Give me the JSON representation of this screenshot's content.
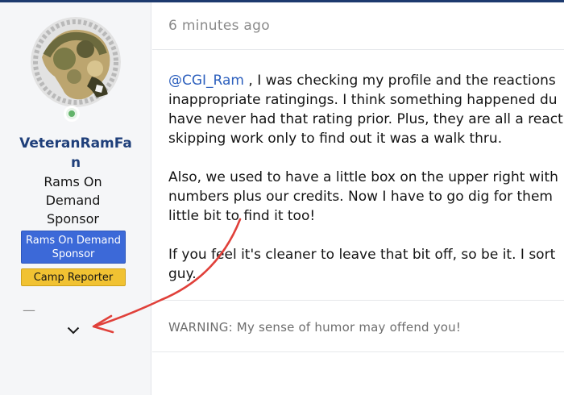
{
  "post": {
    "timestamp": "6 minutes ago",
    "paragraphs": [
      {
        "mention": "@CGI_Ram",
        "lines": [
          " , I was checking my profile and the reactions",
          "inappropriate ratingings. I think something happened du",
          "have never had that rating prior. Plus, they are all a react",
          "skipping work only to find out it was a walk thru."
        ]
      },
      {
        "lines": [
          "Also, we used to have a little box on the upper right with",
          "numbers plus our credits. Now I have to go dig for them",
          "little bit to find it too!"
        ]
      },
      {
        "lines": [
          "If you feel it's cleaner to leave that bit off, so be it. I sort",
          "guy."
        ]
      }
    ],
    "signature": "WARNING: My sense of humor may offend you!"
  },
  "user": {
    "username": "VeteranRamFan",
    "title": "Rams On Demand Sponsor",
    "banner_primary": "Rams On Demand Sponsor",
    "banner_secondary": "Camp Reporter",
    "separator": "—",
    "online": true,
    "avatar_icon": "camo-ram-head-laurel",
    "expand_icon": "chevron-down-icon"
  },
  "colors": {
    "accent": "#1f3f7a",
    "mention": "#2c5fbd",
    "banner_blue": "#3c69d8",
    "banner_yellow": "#f1c232",
    "online_green": "#63b46a",
    "annotation_red": "#e0403a"
  }
}
